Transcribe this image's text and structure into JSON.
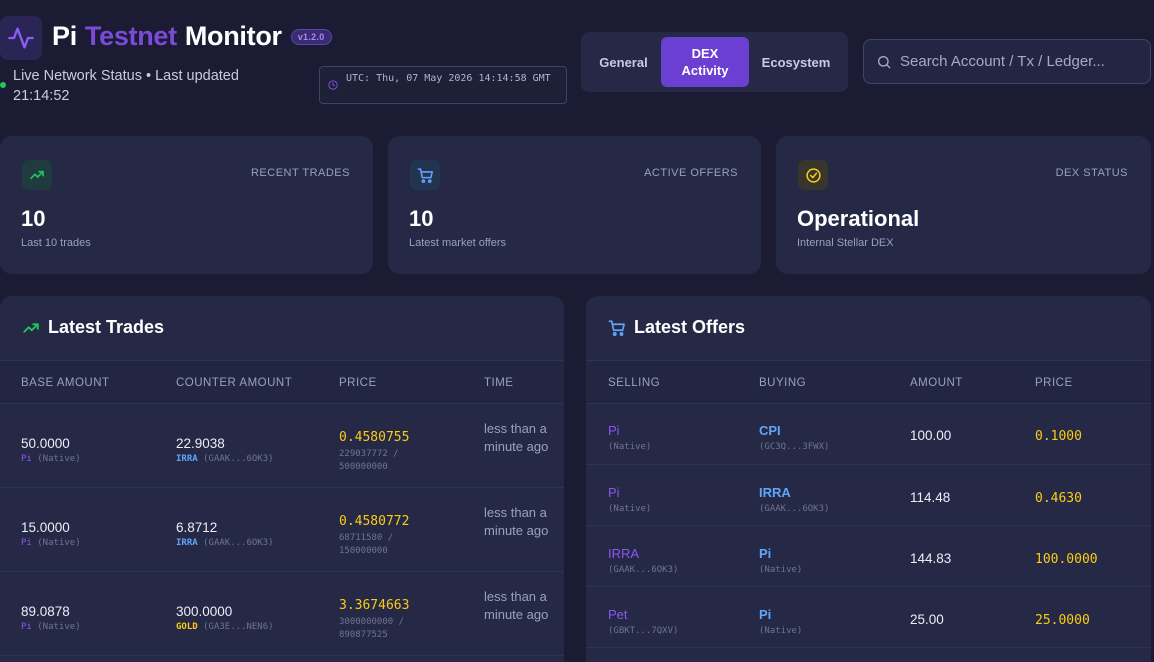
{
  "header": {
    "title_part1": "Pi",
    "title_part2": "Testnet",
    "title_part3": "Monitor",
    "version": "v1.2.0",
    "live_status": "Live Network Status • Last updated 21:14:52",
    "utc_label": "UTC: Thu, 07 May 2026 14:14:58 GMT"
  },
  "tabs": [
    {
      "label": "General"
    },
    {
      "label": "DEX Activity"
    },
    {
      "label": "Ecosystem"
    }
  ],
  "search": {
    "placeholder": "Search Account / Tx / Ledger..."
  },
  "stats": [
    {
      "label": "RECENT TRADES",
      "value": "10",
      "sub": "Last 10 trades",
      "icon": "trending-up-icon"
    },
    {
      "label": "ACTIVE OFFERS",
      "value": "10",
      "sub": "Latest market offers",
      "icon": "cart-icon"
    },
    {
      "label": "DEX STATUS",
      "value": "Operational",
      "sub": "Internal Stellar DEX",
      "icon": "check-circle-icon"
    }
  ],
  "trades": {
    "title": "Latest Trades",
    "columns": [
      "BASE AMOUNT",
      "COUNTER AMOUNT",
      "PRICE",
      "TIME"
    ],
    "rows": [
      {
        "base": "50.0000",
        "base_asset": "Pi",
        "base_issuer": "(Native)",
        "counter": "22.9038",
        "counter_asset": "IRRA",
        "counter_issuer": "(GAAK...6OK3)",
        "price": "0.4580755",
        "price_frac": "229037772 / 500000000",
        "time": "less than a minute ago"
      },
      {
        "base": "15.0000",
        "base_asset": "Pi",
        "base_issuer": "(Native)",
        "counter": "6.8712",
        "counter_asset": "IRRA",
        "counter_issuer": "(GAAK...6OK3)",
        "price": "0.4580772",
        "price_frac": "68711580 / 150000000",
        "time": "less than a minute ago"
      },
      {
        "base": "89.0878",
        "base_asset": "Pi",
        "base_issuer": "(Native)",
        "counter": "300.0000",
        "counter_asset": "GOLD",
        "counter_issuer": "(GA3E...NEN6)",
        "price": "3.3674663",
        "price_frac": "3000000000 / 890877525",
        "time": "less than a minute ago"
      }
    ]
  },
  "offers": {
    "title": "Latest Offers",
    "columns": [
      "SELLING",
      "BUYING",
      "AMOUNT",
      "PRICE"
    ],
    "rows": [
      {
        "selling": "Pi",
        "selling_sub": "(Native)",
        "buying": "CPI",
        "buying_sub": "(GC3Q...3FWX)",
        "amount": "100.00",
        "price": "0.1000"
      },
      {
        "selling": "Pi",
        "selling_sub": "(Native)",
        "buying": "IRRA",
        "buying_sub": "(GAAK...6OK3)",
        "amount": "114.48",
        "price": "0.4630"
      },
      {
        "selling": "IRRA",
        "selling_sub": "(GAAK...6OK3)",
        "buying": "Pi",
        "buying_sub": "(Native)",
        "amount": "144.83",
        "price": "100.0000"
      },
      {
        "selling": "Pet",
        "selling_sub": "(GBKT...7QXV)",
        "buying": "Pi",
        "buying_sub": "(Native)",
        "amount": "25.00",
        "price": "25.0000"
      }
    ]
  },
  "colors": {
    "background": "#1b1c33",
    "card": "#262945",
    "accent_purple": "#6b3fd1",
    "price_yellow": "#facc15",
    "asset_blue": "#60a5fa",
    "live_green": "#22c55e"
  }
}
